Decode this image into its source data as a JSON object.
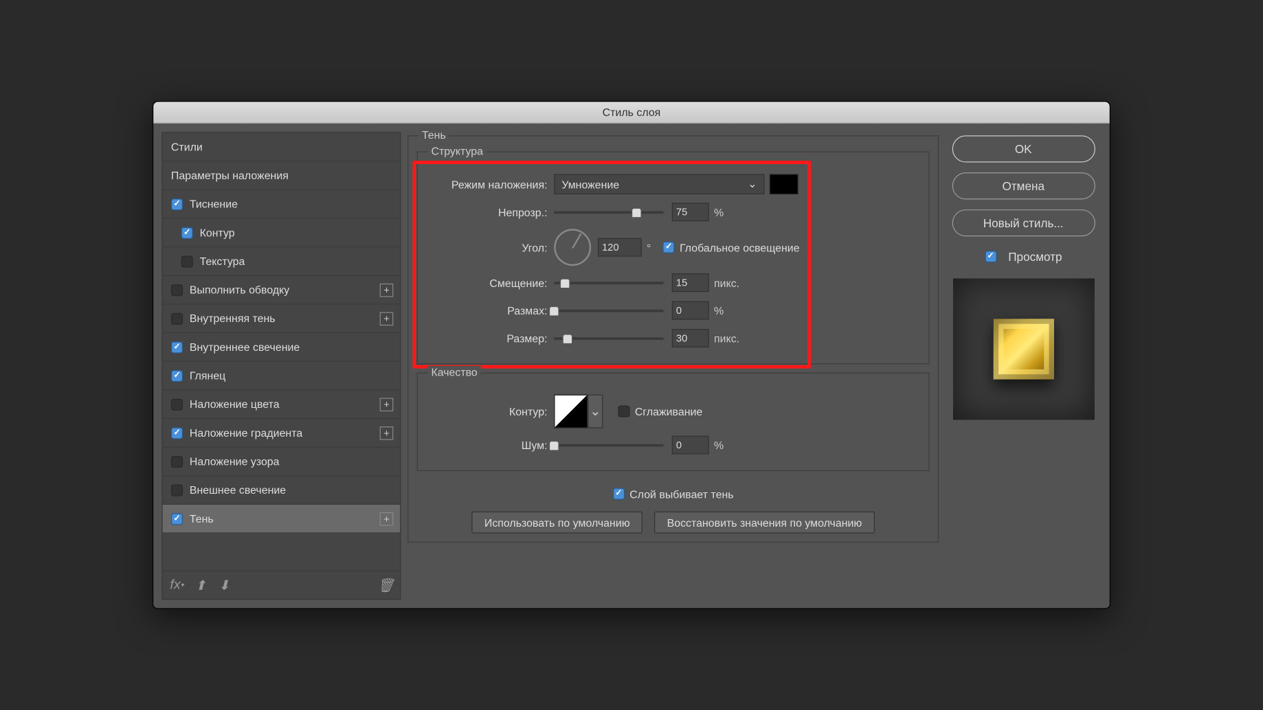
{
  "title": "Стиль слоя",
  "left": {
    "styles": "Стили",
    "blendopt": "Параметры наложения",
    "items": [
      {
        "label": "Тиснение",
        "checked": true,
        "plus": false,
        "sub": false
      },
      {
        "label": "Контур",
        "checked": true,
        "plus": false,
        "sub": true
      },
      {
        "label": "Текстура",
        "checked": false,
        "plus": false,
        "sub": true
      },
      {
        "label": "Выполнить обводку",
        "checked": false,
        "plus": true,
        "sub": false
      },
      {
        "label": "Внутренняя тень",
        "checked": false,
        "plus": true,
        "sub": false
      },
      {
        "label": "Внутреннее свечение",
        "checked": true,
        "plus": false,
        "sub": false
      },
      {
        "label": "Глянец",
        "checked": true,
        "plus": false,
        "sub": false
      },
      {
        "label": "Наложение цвета",
        "checked": false,
        "plus": true,
        "sub": false
      },
      {
        "label": "Наложение градиента",
        "checked": true,
        "plus": true,
        "sub": false
      },
      {
        "label": "Наложение узора",
        "checked": false,
        "plus": false,
        "sub": false
      },
      {
        "label": "Внешнее свечение",
        "checked": false,
        "plus": false,
        "sub": false
      },
      {
        "label": "Тень",
        "checked": true,
        "plus": true,
        "sub": false,
        "selected": true
      }
    ],
    "fx": "fx"
  },
  "center": {
    "group_shadow": "Тень",
    "group_struct": "Структура",
    "group_quality": "Качество",
    "blend_label": "Режим наложения:",
    "blend_value": "Умножение",
    "opacity_label": "Непрозр.:",
    "opacity": "75",
    "opacity_unit": "%",
    "angle_label": "Угол:",
    "angle": "120",
    "angle_unit": "°",
    "global_light": "Глобальное освещение",
    "offset_label": "Смещение:",
    "offset": "15",
    "offset_unit": "пикс.",
    "spread_label": "Размах:",
    "spread": "0",
    "spread_unit": "%",
    "size_label": "Размер:",
    "size": "30",
    "size_unit": "пикс.",
    "contour_label": "Контур:",
    "antialias": "Сглаживание",
    "noise_label": "Шум:",
    "noise": "0",
    "noise_unit": "%",
    "knockout": "Слой выбивает тень",
    "make_default": "Использовать по умолчанию",
    "reset_default": "Восстановить значения по умолчанию",
    "shadow_color": "#000000"
  },
  "right": {
    "ok": "OK",
    "cancel": "Отмена",
    "newstyle": "Новый стиль...",
    "preview": "Просмотр"
  }
}
